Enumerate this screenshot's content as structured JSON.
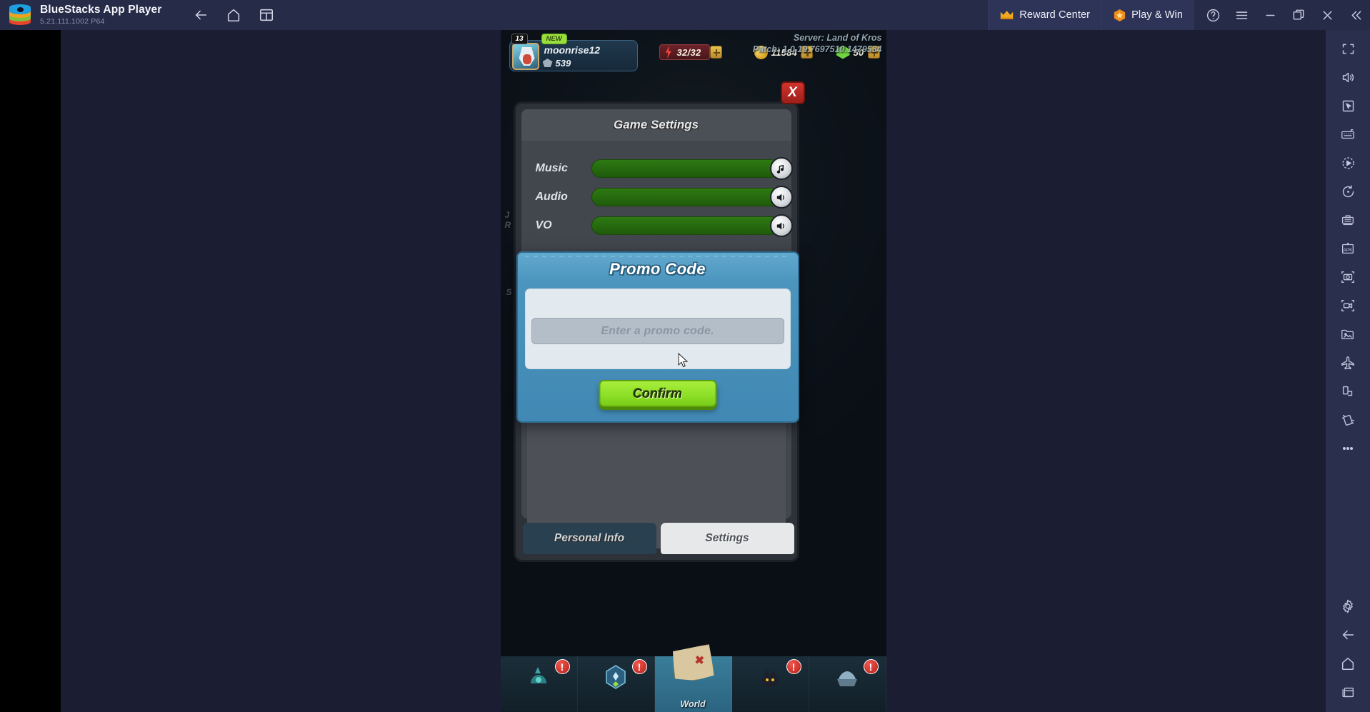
{
  "app": {
    "title": "BlueStacks App Player",
    "version": "5.21.111.1002  P64",
    "logo_icon": "bluestacks-logo"
  },
  "titlebar": {
    "nav": [
      {
        "name": "back",
        "icon": "arrow-left-icon"
      },
      {
        "name": "home",
        "icon": "home-icon"
      },
      {
        "name": "multi-instance",
        "icon": "windows-icon"
      }
    ],
    "promos": [
      {
        "label": "Reward Center",
        "icon": "crown-icon"
      },
      {
        "label": "Play & Win",
        "icon": "hex-star-icon"
      }
    ],
    "window_controls": [
      {
        "name": "help",
        "icon": "question-circle-icon"
      },
      {
        "name": "menu",
        "icon": "hamburger-icon"
      },
      {
        "name": "minimize",
        "icon": "minimize-icon"
      },
      {
        "name": "maximize",
        "icon": "maximize-icon"
      },
      {
        "name": "close",
        "icon": "close-icon"
      },
      {
        "name": "collapse-sidebar",
        "icon": "chevron-double-left-icon"
      }
    ]
  },
  "sidebar": {
    "items": [
      {
        "name": "fullscreen",
        "icon": "fullscreen-icon"
      },
      {
        "name": "volume",
        "icon": "volume-icon"
      },
      {
        "name": "pointer",
        "icon": "cursor-pointer-icon"
      },
      {
        "name": "keymapping",
        "icon": "keyboard-icon"
      },
      {
        "name": "macro-record",
        "icon": "play-circle-icon"
      },
      {
        "name": "rotate",
        "icon": "rotate-icon"
      },
      {
        "name": "multi-instance-manager",
        "icon": "instance-manager-icon"
      },
      {
        "name": "install-apk",
        "icon": "apk-icon"
      },
      {
        "name": "screenshot",
        "icon": "camera-icon"
      },
      {
        "name": "screen-record",
        "icon": "video-camera-icon"
      },
      {
        "name": "media-manager",
        "icon": "image-folder-icon"
      },
      {
        "name": "eco-mode",
        "icon": "airplane-icon"
      },
      {
        "name": "tilt-control",
        "icon": "device-rotate-icon"
      },
      {
        "name": "shake",
        "icon": "shake-icon"
      },
      {
        "name": "more",
        "icon": "ellipsis-icon"
      },
      {
        "name": "settings",
        "icon": "gear-icon"
      },
      {
        "name": "android-back",
        "icon": "arrow-left-icon"
      },
      {
        "name": "android-home",
        "icon": "home-icon"
      },
      {
        "name": "android-recents",
        "icon": "recents-icon"
      }
    ]
  },
  "game": {
    "hud": {
      "level": "13",
      "new_badge": "NEW",
      "player_name": "moonrise12",
      "power": "539",
      "energy": "32/32",
      "coins": "11584",
      "gems": "50"
    },
    "settings_panel": {
      "title": "Game Settings",
      "rows": [
        {
          "label": "Music",
          "icon": "music-note-icon",
          "value": 100
        },
        {
          "label": "Audio",
          "icon": "speaker-icon",
          "value": 100
        },
        {
          "label": "VO",
          "icon": "speaker-icon",
          "value": 100
        }
      ],
      "close_label": "X",
      "tabs": [
        {
          "label": "Personal Info",
          "active": false
        },
        {
          "label": "Settings",
          "active": true
        }
      ]
    },
    "promo_dialog": {
      "title": "Promo Code",
      "input_value": "",
      "input_placeholder": "Enter a promo code.",
      "confirm_label": "Confirm"
    },
    "bottom_nav": [
      {
        "label": "",
        "icon": "cauldron-icon",
        "alert": "!"
      },
      {
        "label": "",
        "icon": "gem-bag-icon",
        "alert": "!"
      },
      {
        "label": "World",
        "icon": "map-icon",
        "alert": ""
      },
      {
        "label": "",
        "icon": "heroes-icon",
        "alert": "!"
      },
      {
        "label": "",
        "icon": "shop-icon",
        "alert": "!"
      }
    ],
    "server_line_1": "Server: Land of Kros",
    "server_line_2": "Patch: 1.0.19.7697510.1479534"
  },
  "colors": {
    "titlebar_bg": "#262b47",
    "sidebar_bg": "#2a2f4d",
    "viewport_bg": "#1b1d33",
    "dialog_blue": "#4a94bd",
    "confirm_green": "#8ee028",
    "slider_green": "#2e7a13",
    "close_red": "#d3332c"
  }
}
